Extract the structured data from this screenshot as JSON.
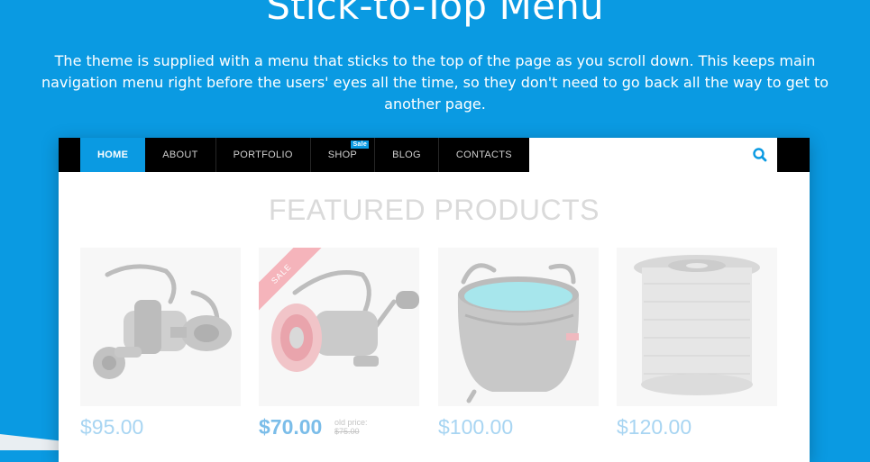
{
  "hero": {
    "title": "Stick-to-Top Menu",
    "description": "The theme is supplied with a menu that sticks to the top of the page as you scroll down. This keeps main navigation menu right before the users' eyes all the time, so they don't need to go back all the way to get to another page."
  },
  "nav": {
    "items": [
      {
        "label": "HOME",
        "active": true
      },
      {
        "label": "ABOUT"
      },
      {
        "label": "PORTFOLIO"
      },
      {
        "label": "SHOP",
        "badge": "Sale"
      },
      {
        "label": "BLOG"
      },
      {
        "label": "CONTACTS"
      }
    ],
    "search_icon": "search-icon"
  },
  "featured": {
    "title": "FEATURED PRODUCTS"
  },
  "products": [
    {
      "image": "spinning-reel-black",
      "price": "$95.00"
    },
    {
      "image": "spinning-reel-red",
      "ribbon": "SALE",
      "price": "$70.00",
      "old_price_label": "old price:",
      "old_price": "$75.00"
    },
    {
      "image": "collapsible-bucket",
      "price": "$100.00"
    },
    {
      "image": "fishing-line-spool",
      "price": "$120.00"
    }
  ],
  "colors": {
    "accent": "#0a9ae2",
    "nav_bg": "#000000",
    "sale_ribbon": "#f5b4bb"
  }
}
